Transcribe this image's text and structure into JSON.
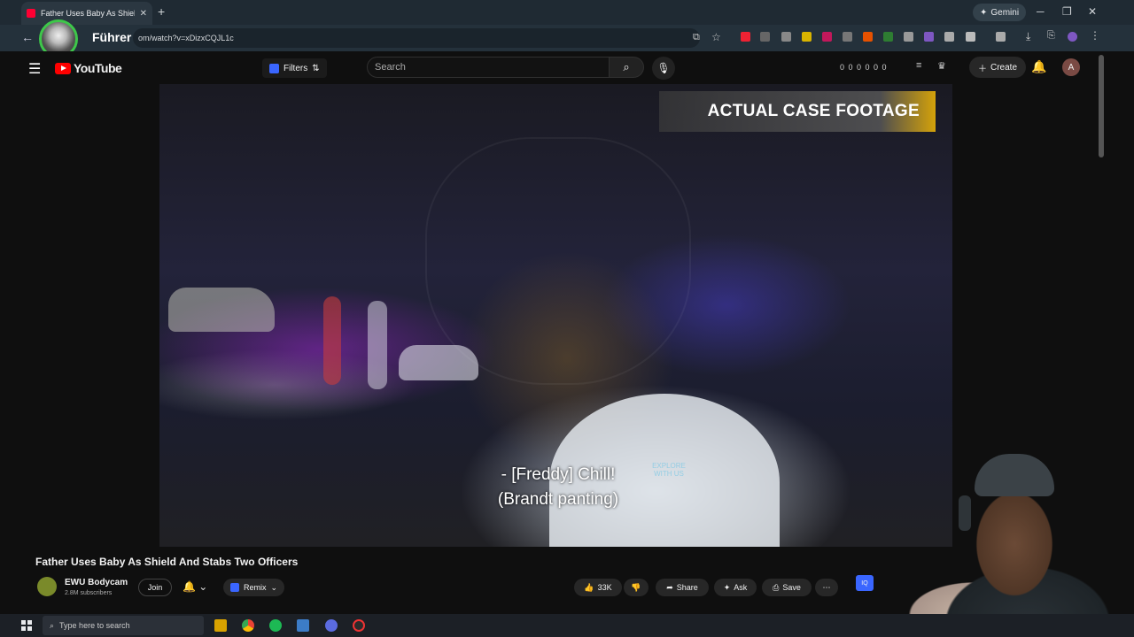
{
  "browser": {
    "tab_title": "Father Uses Baby As Shield And Stabs Two Officers",
    "gemini_label": "Gemini",
    "url_text": "om/watch?v=xDizxCQJL1c",
    "overlay_name": "Führer"
  },
  "youtube": {
    "logo_text": "YouTube",
    "filters_label": "Filters",
    "search_placeholder": "Search",
    "stats_text": "0 0 0 0 0 0",
    "create_label": "Create",
    "account_initial": "A"
  },
  "video": {
    "badge_text": "ACTUAL CASE FOOTAGE",
    "subtitle_line1": "- [Freddy] Chill!",
    "subtitle_line2": "(Brandt panting)",
    "watermark_text": "EXPLORE WITH US"
  },
  "details": {
    "title": "Father Uses Baby As Shield And Stabs Two Officers",
    "channel_name": "EWU Bodycam",
    "channel_subs": "2.8M subscribers",
    "join_label": "Join",
    "remix_label": "Remix",
    "likes": "33K",
    "share_label": "Share",
    "ask_label": "Ask",
    "save_label": "Save"
  },
  "taskbar": {
    "search_placeholder": "Type here to search"
  },
  "colors": {
    "yt_red": "#ff0000",
    "iq_blue": "#3a66ff",
    "avatar_ring": "#3ec74a"
  }
}
